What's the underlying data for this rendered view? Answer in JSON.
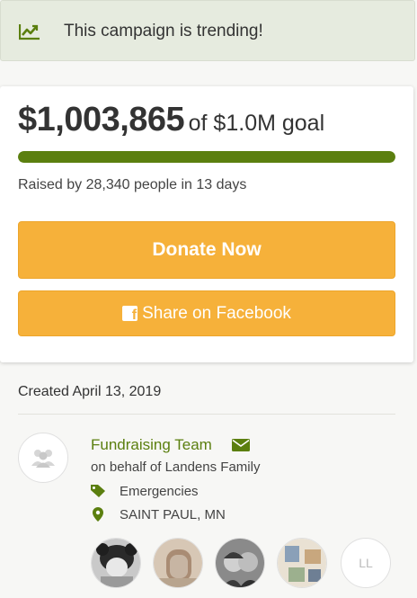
{
  "trending": {
    "text": "This campaign is trending!",
    "icon": "trending-chart-icon"
  },
  "campaign": {
    "amount": "$1,003,865",
    "goal_text": "of $1.0M goal",
    "progress_fraction": 1.0,
    "raised_text": "Raised by 28,340 people in 13 days",
    "donate_label": "Donate Now",
    "share_label": "Share on Facebook"
  },
  "details": {
    "created": "Created April 13, 2019",
    "organizer": "Fundraising Team",
    "behalf": "on behalf of Landens Family",
    "category": "Emergencies",
    "location": "SAINT PAUL, MN"
  },
  "donors": [
    {
      "kind": "photo"
    },
    {
      "kind": "photo"
    },
    {
      "kind": "photo"
    },
    {
      "kind": "photo"
    },
    {
      "kind": "initials",
      "initials": "LL"
    }
  ],
  "colors": {
    "accent": "#5b7f0f",
    "button": "#f6b13a",
    "banner": "#e6ebdf"
  }
}
